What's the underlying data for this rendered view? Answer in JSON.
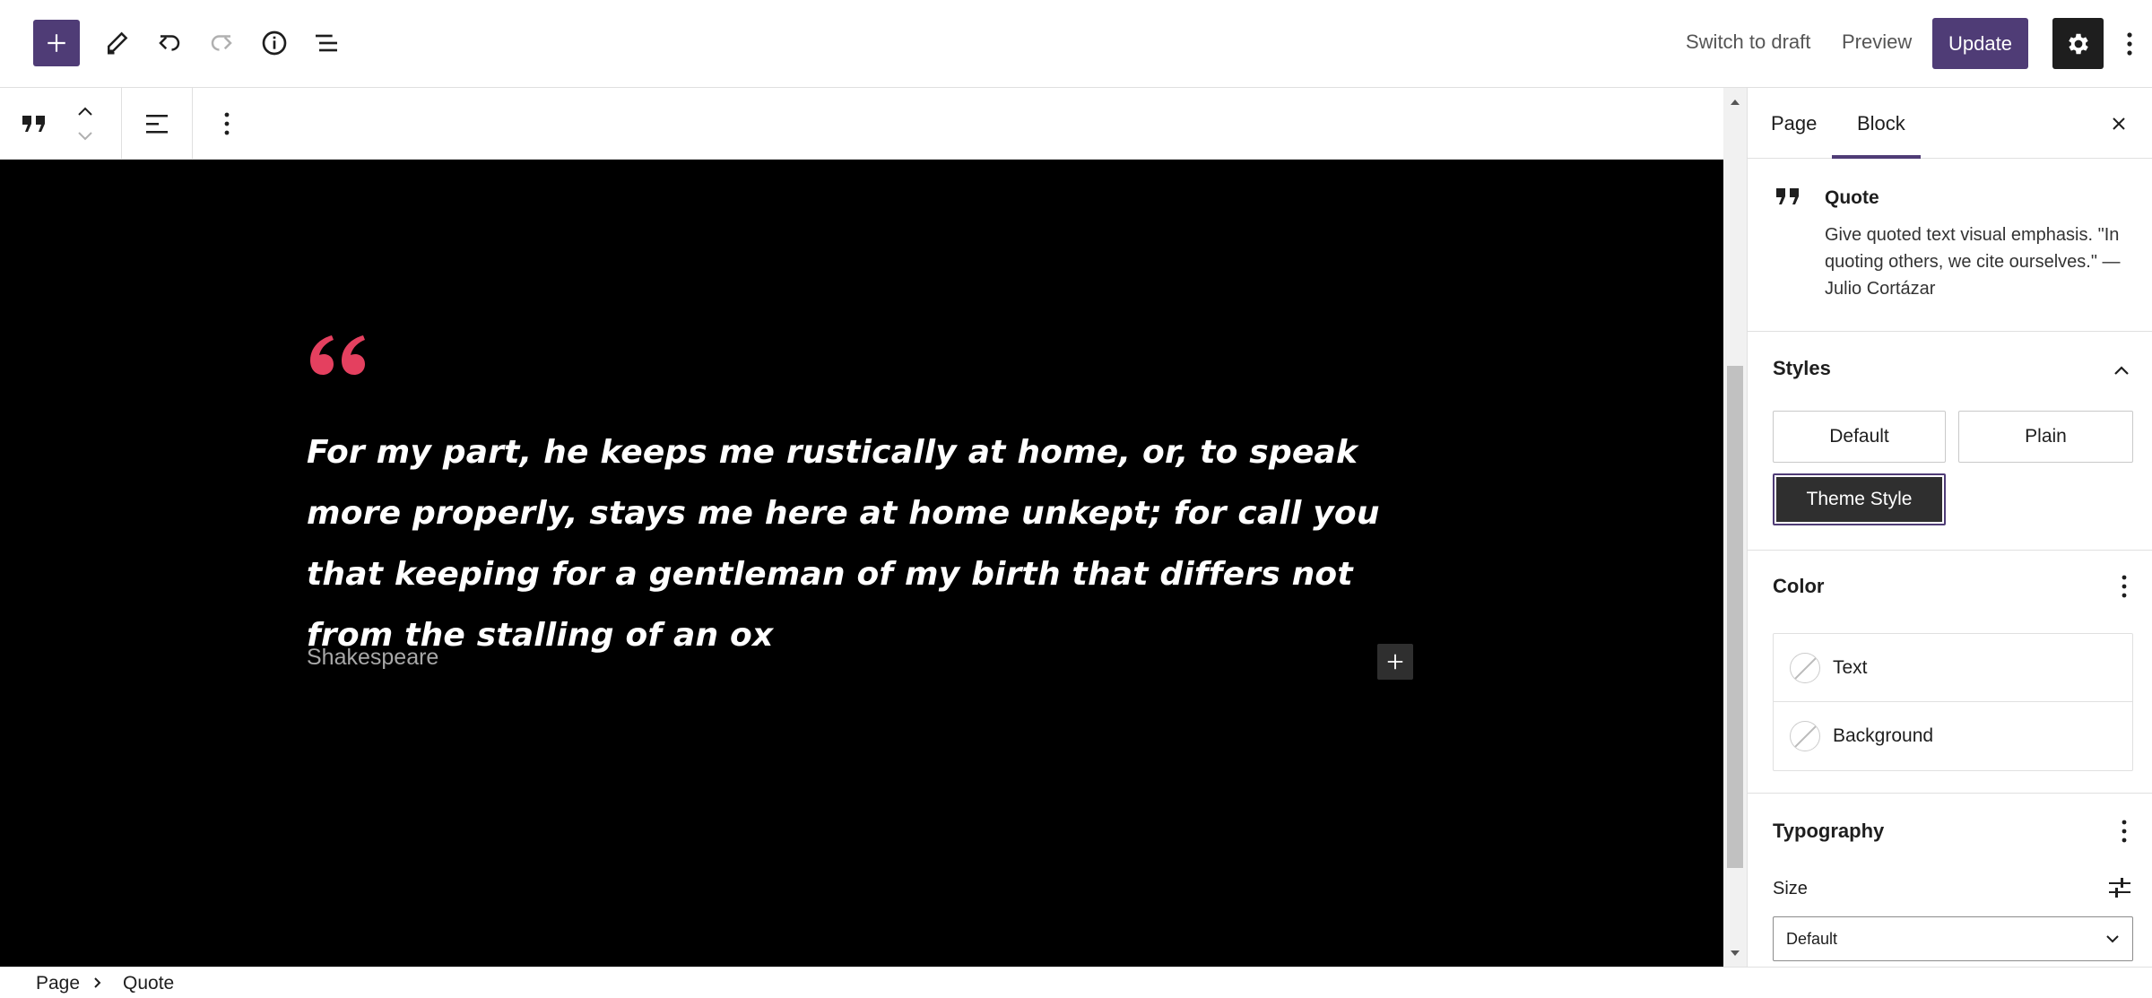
{
  "header": {
    "add_block_icon": "plus-icon",
    "tools_icon": "pencil-icon",
    "undo_icon": "undo-icon",
    "redo_icon": "redo-icon",
    "details_icon": "info-icon",
    "list_view_icon": "list-view-icon",
    "switch_to_draft": "Switch to draft",
    "preview": "Preview",
    "update": "Update",
    "settings_icon": "gear-icon",
    "options_icon": "vertical-ellipsis-icon"
  },
  "block_toolbar": {
    "block_type_icon": "quote-icon",
    "move_up_icon": "chevron-up-icon",
    "move_down_icon": "chevron-down-icon",
    "align_icon": "align-left-icon",
    "options_icon": "vertical-ellipsis-icon"
  },
  "canvas": {
    "quote_text": "For my part, he keeps me rustically at home, or, to speak more properly, stays me here at home unkept; for call you that keeping for a gentleman of my birth that differs not from the stalling of an ox",
    "citation": "Shakespeare",
    "quote_mark_color": "#e4405f",
    "background": "#000000"
  },
  "sidebar": {
    "tabs": [
      {
        "label": "Page"
      },
      {
        "label": "Block",
        "active": true
      }
    ],
    "block_card": {
      "title": "Quote",
      "description": "Give quoted text visual emphasis. \"In quoting others, we cite ourselves.\" — Julio Cortázar"
    },
    "styles": {
      "title": "Styles",
      "options": [
        "Default",
        "Plain",
        "Theme Style"
      ],
      "selected": "Theme Style"
    },
    "color": {
      "title": "Color",
      "items": [
        "Text",
        "Background"
      ]
    },
    "typography": {
      "title": "Typography",
      "size_label": "Size",
      "size_value": "Default"
    }
  },
  "footer": {
    "breadcrumbs": [
      "Page",
      "Quote"
    ]
  },
  "colors": {
    "accent": "#4f3c76",
    "dark": "#1e1e1e",
    "quote_mark": "#e4405f"
  }
}
